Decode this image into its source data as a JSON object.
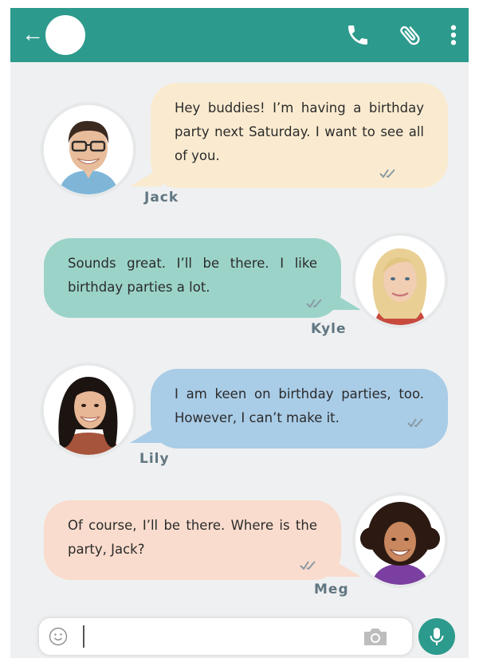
{
  "header": {
    "back_icon": "back-arrow-icon",
    "call_icon": "phone-icon",
    "attach_icon": "paperclip-icon",
    "menu_icon": "more-vertical-icon",
    "color": "#2c9a8c"
  },
  "messages": [
    {
      "sender": "Jack",
      "text": "Hey buddies! I’m having a birthday party next Saturday. I want to see all of you.",
      "color": "#faebd0",
      "side": "left",
      "status": "read"
    },
    {
      "sender": "Kyle",
      "text": "Sounds great. I’ll be there. I like birthday parties a lot.",
      "color": "#9bd3c9",
      "side": "right",
      "status": "read"
    },
    {
      "sender": "Lily",
      "text": "I am keen on birthday parties, too. However, I can’t make it.",
      "color": "#a9cce7",
      "side": "left",
      "status": "read"
    },
    {
      "sender": "Meg",
      "text": "Of course, I’ll be there. Where is the party, Jack?",
      "color": "#f9dccd",
      "side": "right",
      "status": "read"
    }
  ],
  "composer": {
    "value": "",
    "placeholder": "",
    "emoji_icon": "emoji-icon",
    "camera_icon": "camera-icon",
    "mic_icon": "microphone-icon"
  }
}
